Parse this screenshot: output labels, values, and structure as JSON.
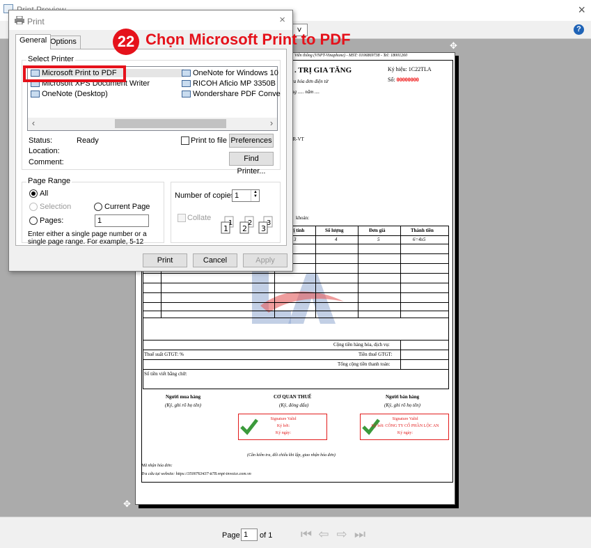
{
  "window": {
    "title": "Print Preview",
    "close": "×"
  },
  "toolbar": {
    "zoom_chevron": "˅",
    "help": "?"
  },
  "bottombar": {
    "page_label": "Page",
    "page_value": "1",
    "of_text": "of 1"
  },
  "document": {
    "header_line": "Viễn thông (VNPT-Vinaphone) - MST: 0106869738 - Tel: 18001260",
    "invoice_name": ". TRỊ GIA TĂNG",
    "invoice_sub": "ra hóa đơn điện tử",
    "invoice_date": "ng ..... năm ....",
    "ky_hieu": "Ký hiệu: 1C22TLA",
    "so_label": "Số:",
    "so_value": "00000000",
    "tax_code": "3R-VT",
    "payment": "khoản:",
    "columns": [
      "vị tính",
      "Số lượng",
      "Đơn giá",
      "Thành tiền"
    ],
    "col_index": [
      "3",
      "4",
      "5",
      "6=4x5"
    ],
    "totals": {
      "subtotal": "Cộng tiền hàng hóa, dịch vụ:",
      "vat_rate": "Thuế suất GTGT: %",
      "vat_amount": "Tiền thuế GTGT:",
      "grand_total": "Tổng cộng tiền thanh toán:",
      "in_words": "Số tiền viết bằng chữ:"
    },
    "signers": [
      {
        "title": "Người mua hàng",
        "note": "(Ký, ghi rõ họ tên)"
      },
      {
        "title": "CƠ QUAN THUẾ",
        "note": "(Ký, đóng dấu)"
      },
      {
        "title": "Người bán hàng",
        "note": "(Ký, ghi rõ họ tên)"
      }
    ],
    "sig_left": {
      "l1": "Signature Valid",
      "l2": "Ký bởi:",
      "l3": "Ký ngày:"
    },
    "sig_right": {
      "l1": "Signature Valid",
      "l2": "Ký bởi: CÔNG TY CỔ PHẦN LỘC AN",
      "l3": "Ký ngày:"
    },
    "check_note": "(Cần kiểm tra, đối chiếu khi lập, giao nhận hóa đơn)",
    "lookup_code": "Mã nhận hóa đơn:",
    "lookup_site": "Tra cứu tại website: https://3500763437-tt78.vnpt-invoice.com.vn"
  },
  "dialog": {
    "title": "Print",
    "close": "×",
    "tabs": [
      {
        "label": "General"
      },
      {
        "label": "Options"
      }
    ],
    "select_printer_label": "Select Printer",
    "printers": [
      {
        "name": "Microsoft Print to PDF"
      },
      {
        "name": "Microsoft XPS Document Writer"
      },
      {
        "name": "OneNote (Desktop)"
      },
      {
        "name": "OneNote for Windows 10"
      },
      {
        "name": "RICOH Aficio MP 3350B"
      },
      {
        "name": "Wondershare PDF Conve"
      }
    ],
    "status_label": "Status:",
    "status_value": "Ready",
    "location_label": "Location:",
    "comment_label": "Comment:",
    "print_to_file": "Print to file",
    "preferences": "Preferences",
    "find_printer": "Find Printer...",
    "page_range_label": "Page Range",
    "all": "All",
    "selection": "Selection",
    "current_page": "Current Page",
    "pages": "Pages:",
    "pages_value": "1",
    "range_help": "Enter either a single page number or a single page range.  For example, 5-12",
    "copies_label": "Number of copies:",
    "copies_value": "1",
    "collate": "Collate",
    "print_btn": "Print",
    "cancel_btn": "Cancel",
    "apply_btn": "Apply"
  },
  "annotation": {
    "step": "22",
    "text": "Chọn Microsoft Print to PDF",
    "color": "#e5121b"
  }
}
